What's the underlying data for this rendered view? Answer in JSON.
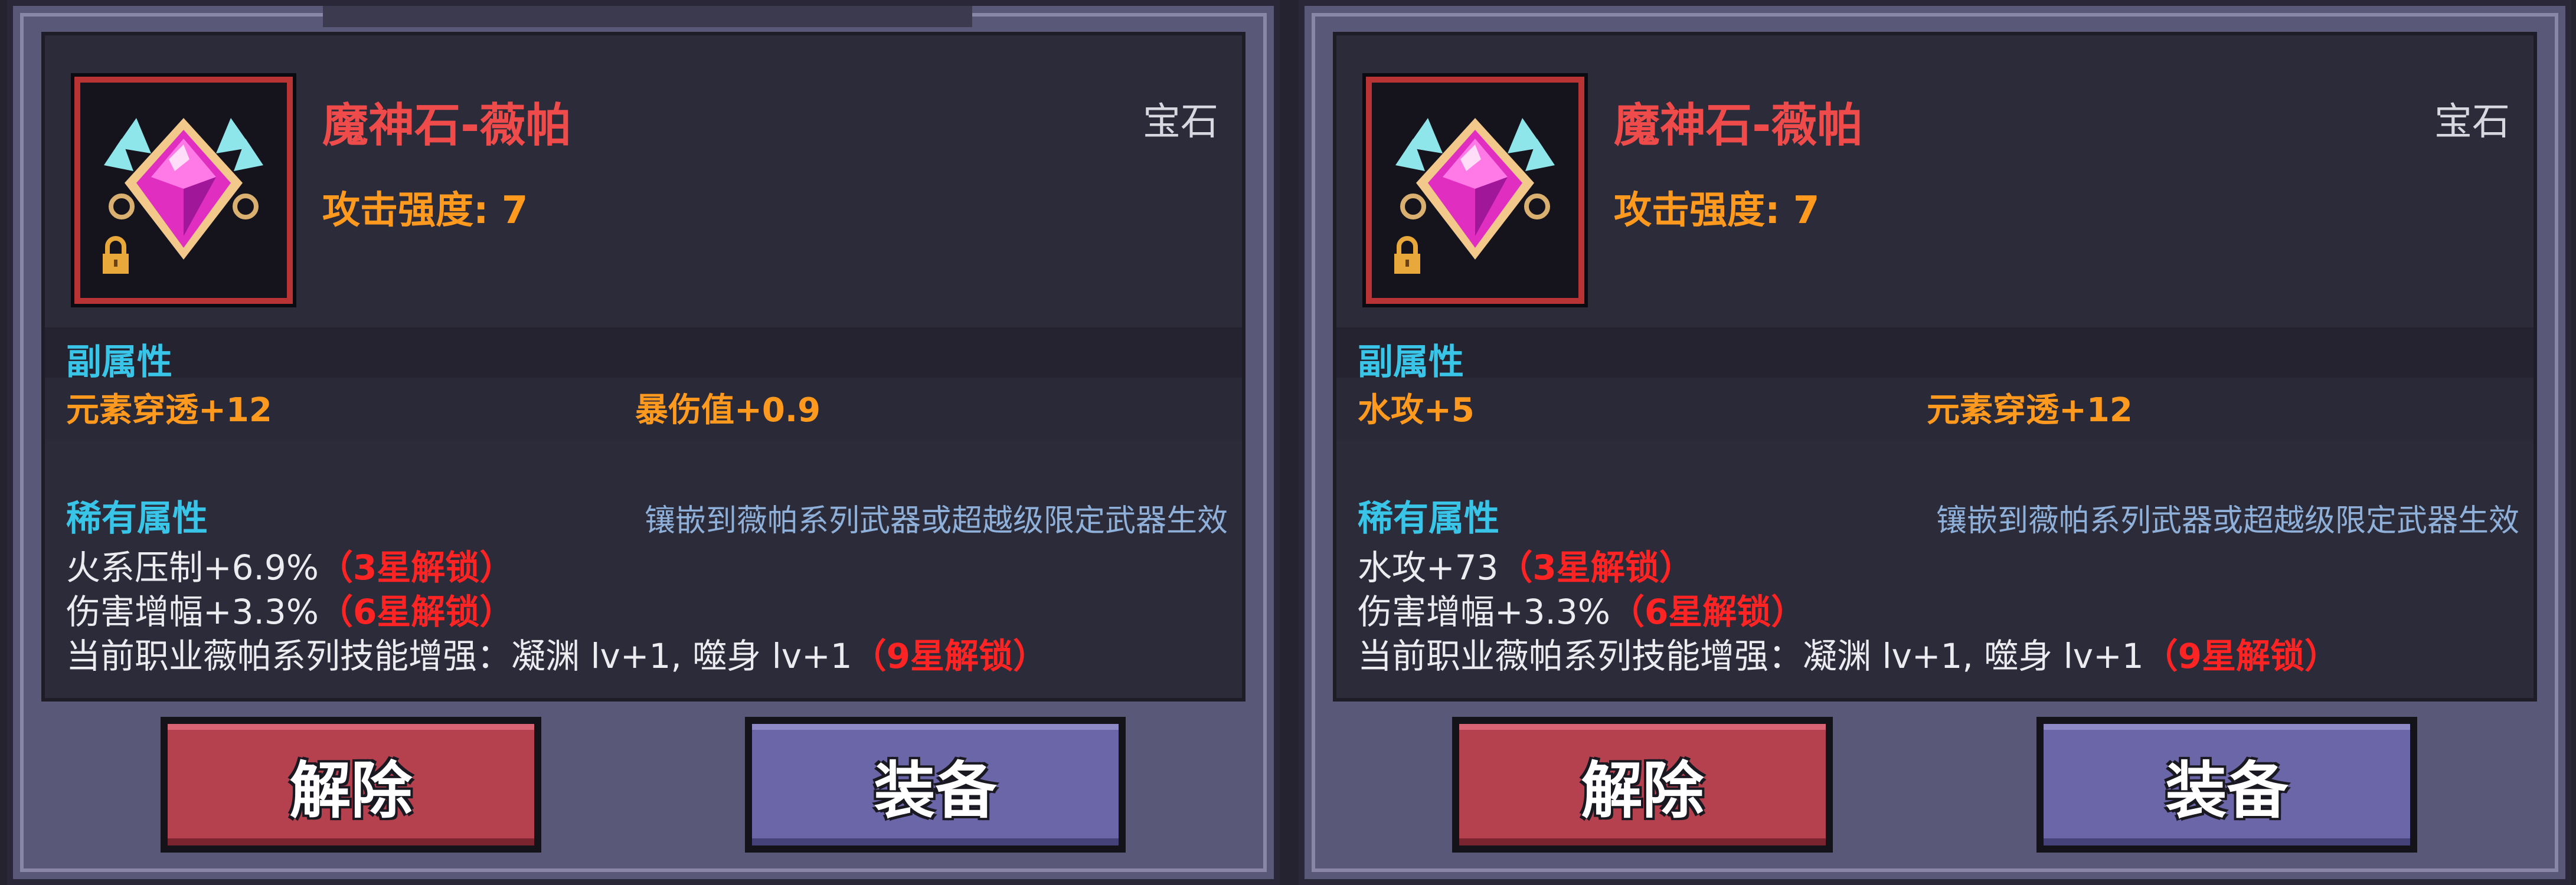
{
  "panels": [
    {
      "item": {
        "name": "魔神石-薇帕",
        "type": "宝石",
        "attack": "攻击强度: 7"
      },
      "sub": {
        "title": "副属性",
        "attrs": [
          "元素穿透+12",
          "暴伤值+0.9"
        ]
      },
      "rare": {
        "title": "稀有属性",
        "note": "镶嵌到薇帕系列武器或超越级限定武器生效",
        "lines": [
          {
            "text": "火系压制+6.9%",
            "lock": "（3星解锁）"
          },
          {
            "text": "伤害增幅+3.3%",
            "lock": "（6星解锁）"
          },
          {
            "text": "当前职业薇帕系列技能增强：凝渊 lv+1, 噬身 lv+1",
            "lock": "（9星解锁）"
          }
        ]
      },
      "buttons": {
        "unequip": "解除",
        "equip": "装备"
      }
    },
    {
      "item": {
        "name": "魔神石-薇帕",
        "type": "宝石",
        "attack": "攻击强度: 7"
      },
      "sub": {
        "title": "副属性",
        "attrs": [
          "水攻+5",
          "元素穿透+12"
        ]
      },
      "rare": {
        "title": "稀有属性",
        "note": "镶嵌到薇帕系列武器或超越级限定武器生效",
        "lines": [
          {
            "text": "水攻+73",
            "lock": "（3星解锁）"
          },
          {
            "text": "伤害增幅+3.3%",
            "lock": "（6星解锁）"
          },
          {
            "text": "当前职业薇帕系列技能增强：凝渊 lv+1, 噬身 lv+1",
            "lock": "（9星解锁）"
          }
        ]
      },
      "buttons": {
        "unequip": "解除",
        "equip": "装备"
      }
    }
  ],
  "icons": {
    "gem": "pink-gem-icon",
    "lock": "lock-icon"
  },
  "colors": {
    "name": "#f04b4b",
    "attack": "#ff9a1e",
    "section": "#38c5e8",
    "lock": "#ff2424",
    "unequip_button": "#b5414f",
    "equip_button": "#6a66a8"
  }
}
